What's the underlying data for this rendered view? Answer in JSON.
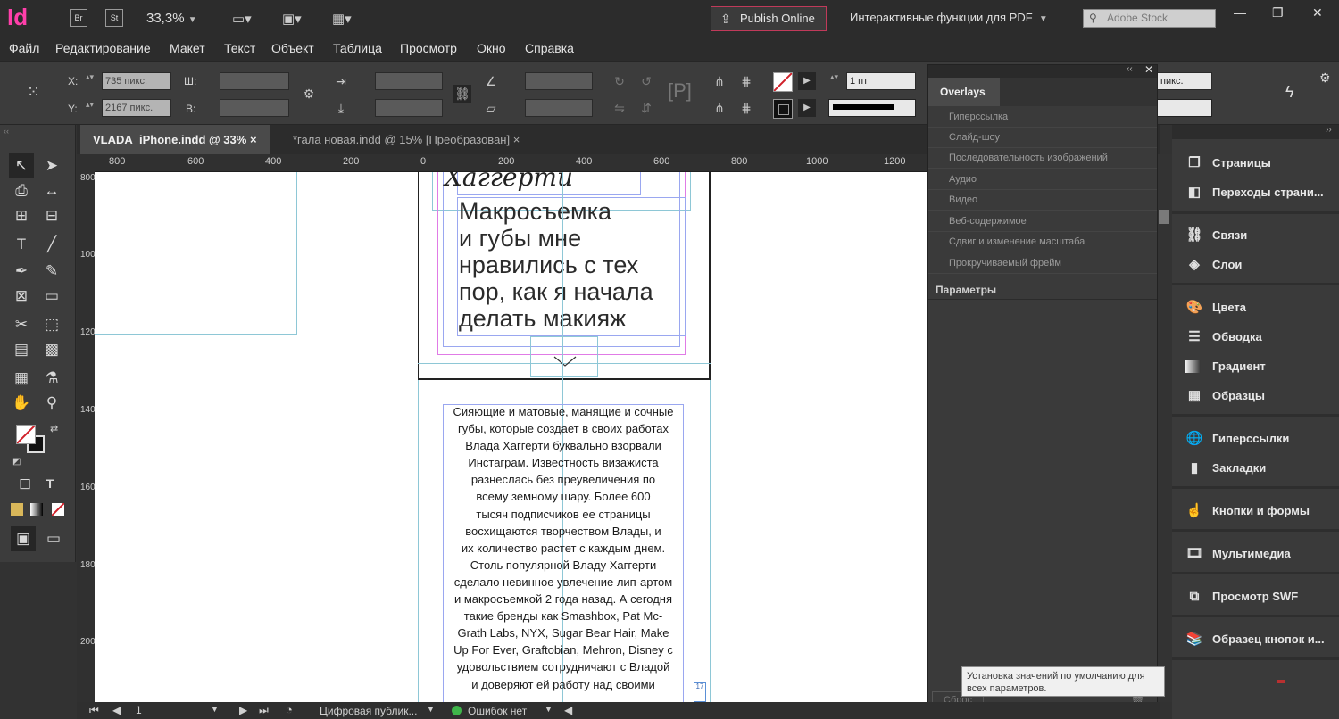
{
  "app": {
    "logo": "Id",
    "bridge": "Br",
    "stock_btn": "St",
    "zoom": "33,3%",
    "publish": "Publish Online",
    "pdf_mode": "Интерактивные функции для PDF",
    "stock_placeholder": "Adobe Stock"
  },
  "menu": [
    "Файл",
    "Редактирование",
    "Макет",
    "Текст",
    "Объект",
    "Таблица",
    "Просмотр",
    "Окно",
    "Справка"
  ],
  "control": {
    "x_label": "X:",
    "x_value": "735 пикс.",
    "y_label": "Y:",
    "y_value": "2167 пикс.",
    "w_label": "Ш:",
    "h_label": "В:",
    "stroke_weight": "1 пт",
    "right_field": "пикс."
  },
  "tabs": [
    {
      "label": "VLADA_iPhone.indd @ 33%",
      "close": "×"
    },
    {
      "label": "*гала новая.indd @ 15% [Преобразован]",
      "close": "×"
    }
  ],
  "ruler_h": [
    "800",
    "600",
    "400",
    "200",
    "0",
    "200",
    "400",
    "600",
    "800",
    "1000",
    "1200"
  ],
  "ruler_v": [
    "800",
    "1000",
    "1200",
    "1400",
    "1600",
    "1800",
    "2000"
  ],
  "document": {
    "script_title": "Хаггерти",
    "headline": [
      "Макросъемка",
      "и губы мне",
      "нравились с тех",
      "пор, как я начала",
      "делать макияж"
    ],
    "body": [
      "Сияющие и матовые, манящие и сочные",
      "губы, которые создает в своих работах",
      "Влада Хаггерти буквально взорвали",
      "Инстаграм. Известность визажиста",
      "разнеслась без преувеличения по",
      "всему земному шару. Более 600",
      "тысяч подписчиков ее страницы",
      "восхищаются творчеством Влады, и",
      "их количество растет с каждым днем.",
      "Столь популярной Владу Хаггерти",
      "сделало невинное увлечение лип-артом",
      "и макросъемкой 2 года назад. А сегодня",
      "такие бренды как Smashbox, Pat Mc-",
      "Grath Labs, NYX, Sugar Bear Hair, Make",
      "Up For Ever, Graftobian, Mehron, Disney с",
      "удовольствием сотрудничают с Владой",
      "и доверяют ей работу над своими"
    ],
    "overset": "17"
  },
  "overlays": {
    "title": "Overlays",
    "items": [
      "Гиперссылка",
      "Слайд-шоу",
      "Последовательность изображений",
      "Аудио",
      "Видео",
      "Веб-содержимое",
      "Сдвиг и изменение масштаба",
      "Прокручиваемый фрейм"
    ],
    "params": "Параметры",
    "reset": "Сброс"
  },
  "panels": [
    {
      "label": "Страницы",
      "icon": "pages-icon"
    },
    {
      "label": "Переходы страни...",
      "icon": "page-transitions-icon"
    },
    {
      "label": "Связи",
      "icon": "links-icon"
    },
    {
      "label": "Слои",
      "icon": "layers-icon"
    },
    {
      "label": "Цвета",
      "icon": "color-icon"
    },
    {
      "label": "Обводка",
      "icon": "stroke-icon"
    },
    {
      "label": "Градиент",
      "icon": "gradient-icon"
    },
    {
      "label": "Образцы",
      "icon": "swatches-icon"
    },
    {
      "label": "Гиперссылки",
      "icon": "hyperlinks-icon"
    },
    {
      "label": "Закладки",
      "icon": "bookmarks-icon"
    },
    {
      "label": "Кнопки и формы",
      "icon": "buttons-icon"
    },
    {
      "label": "Мультимедиа",
      "icon": "media-icon"
    },
    {
      "label": "Просмотр SWF",
      "icon": "swf-preview-icon"
    },
    {
      "label": "Образец кнопок и...",
      "icon": "sample-buttons-icon"
    }
  ],
  "tooltip": {
    "line1": "Установка значений по умолчанию для",
    "line2": "всех параметров."
  },
  "status": {
    "page": "1",
    "profile": "Цифровая публик...",
    "errors": "Ошибок нет"
  }
}
